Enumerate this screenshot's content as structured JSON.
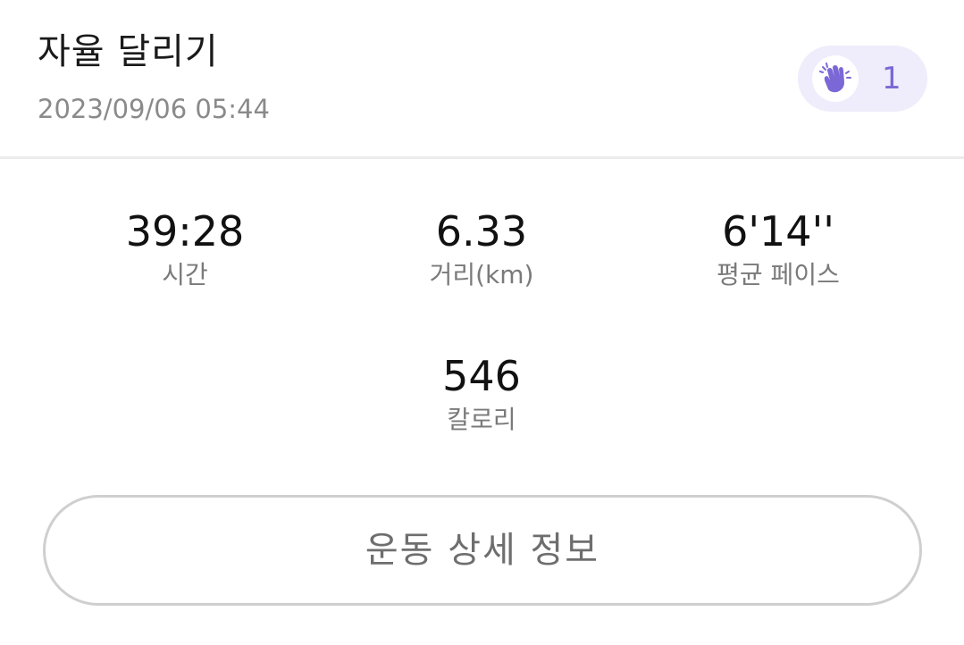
{
  "header": {
    "title": "자율 달리기",
    "date": "2023/09/06 05:44",
    "clap": {
      "icon": "clapping-hands-icon",
      "count": "1",
      "accent_color": "#7b67d6",
      "badge_color": "#efecfb"
    }
  },
  "stats": {
    "time": {
      "value": "39:28",
      "label": "시간"
    },
    "distance": {
      "value": "6.33",
      "label": "거리(km)"
    },
    "pace": {
      "value": "6'14''",
      "label": "평균 페이스"
    },
    "calories": {
      "value": "546",
      "label": "칼로리"
    }
  },
  "actions": {
    "detail_label": "운동 상세 정보"
  }
}
